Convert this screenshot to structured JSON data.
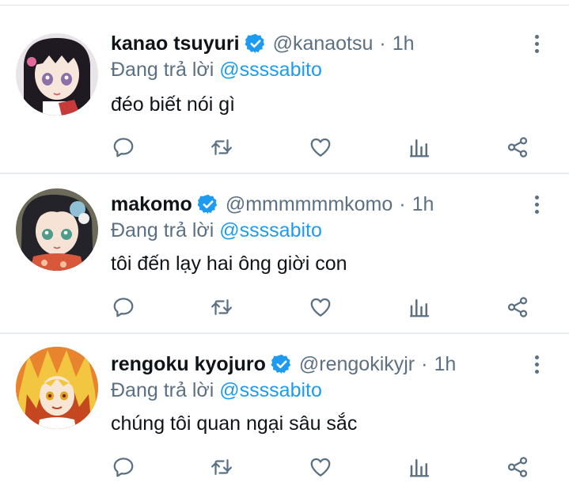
{
  "tweets": [
    {
      "name": "kanao tsuyuri",
      "handle": "@kanaotsu",
      "sep": "·",
      "time": "1h",
      "replying_label": "Đang trả lời",
      "replying_to": "@ssssabito",
      "text": "đéo biết nói gì",
      "avatar": "kanao-avatar"
    },
    {
      "name": "makomo",
      "handle": "@mmmmmmkomo",
      "sep": "·",
      "time": "1h",
      "replying_label": "Đang trả lời",
      "replying_to": "@ssssabito",
      "text": "tôi đến lạy hai ông giời con",
      "avatar": "makomo-avatar"
    },
    {
      "name": "rengoku kyojuro",
      "handle": "@rengokikyjr",
      "sep": "·",
      "time": "1h",
      "replying_label": "Đang trả lời",
      "replying_to": "@ssssabito",
      "text": "chúng tôi quan ngại sâu sắc",
      "avatar": "rengoku-avatar"
    }
  ],
  "icons": [
    "verified-icon",
    "more-icon",
    "reply-icon",
    "retweet-icon",
    "like-icon",
    "analytics-icon",
    "share-icon"
  ],
  "colors": {
    "accent": "#1d9bf0",
    "secondary_text": "#5b7083",
    "primary_text": "#0f1419",
    "verified": "#1d9bf0"
  }
}
